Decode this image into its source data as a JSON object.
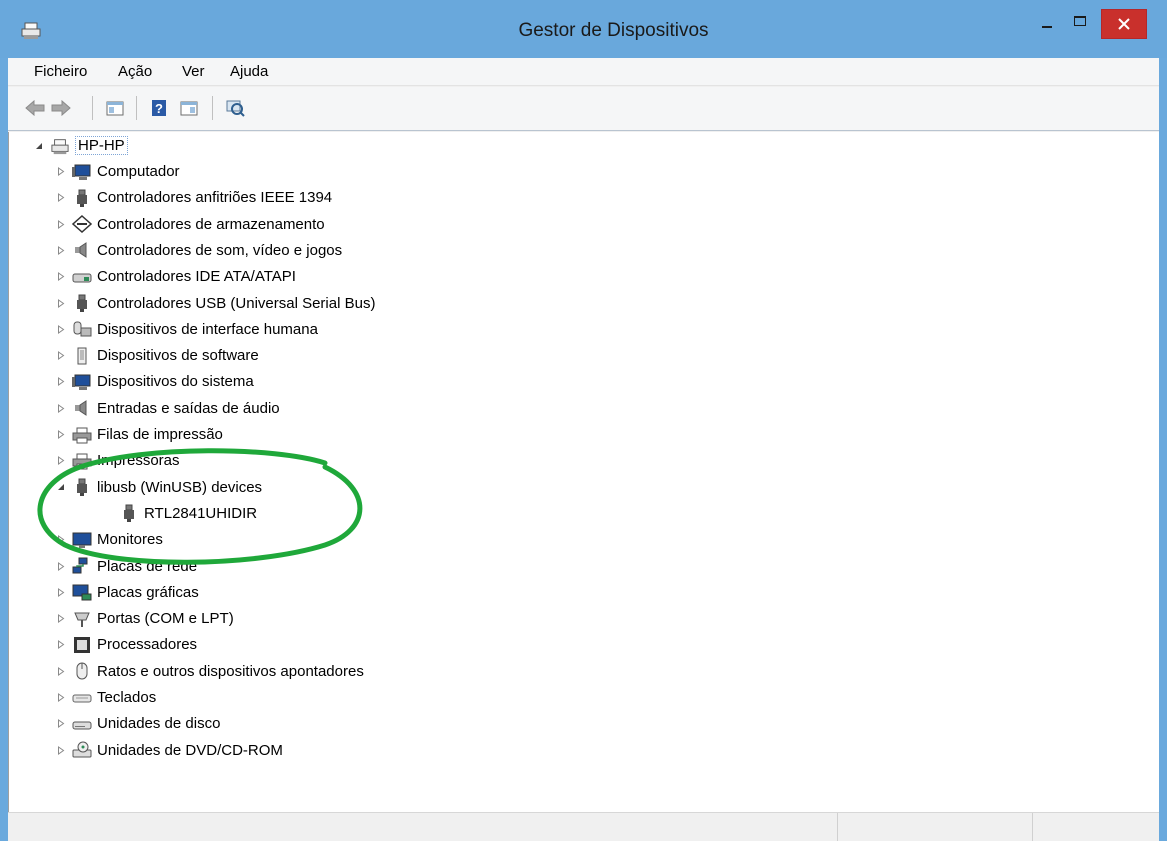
{
  "window": {
    "title": "Gestor de Dispositivos"
  },
  "menu": [
    {
      "label": "Ficheiro"
    },
    {
      "label": "Ação"
    },
    {
      "label": "Ver"
    },
    {
      "label": "Ajuda"
    }
  ],
  "tree": {
    "root": {
      "label": "HP-HP",
      "expanded": true
    },
    "items": [
      {
        "label": "Computador",
        "icon": "computer-icon",
        "expander": "collapsed"
      },
      {
        "label": "Controladores anfitriões IEEE 1394",
        "icon": "usb-plug-icon",
        "expander": "collapsed"
      },
      {
        "label": "Controladores de armazenamento",
        "icon": "storage-controller-icon",
        "expander": "collapsed"
      },
      {
        "label": "Controladores de som, vídeo e jogos",
        "icon": "speaker-icon",
        "expander": "collapsed"
      },
      {
        "label": "Controladores IDE ATA/ATAPI",
        "icon": "ide-controller-icon",
        "expander": "collapsed"
      },
      {
        "label": "Controladores USB (Universal Serial Bus)",
        "icon": "usb-plug-icon",
        "expander": "collapsed"
      },
      {
        "label": "Dispositivos de interface humana",
        "icon": "hid-icon",
        "expander": "collapsed"
      },
      {
        "label": "Dispositivos de software",
        "icon": "software-device-icon",
        "expander": "collapsed"
      },
      {
        "label": "Dispositivos do sistema",
        "icon": "computer-icon",
        "expander": "collapsed"
      },
      {
        "label": "Entradas e saídas de áudio",
        "icon": "speaker-icon",
        "expander": "collapsed"
      },
      {
        "label": "Filas de impressão",
        "icon": "printer-icon",
        "expander": "collapsed"
      },
      {
        "label": "Impressoras",
        "icon": "printer-icon",
        "expander": "collapsed"
      },
      {
        "label": "libusb (WinUSB) devices",
        "icon": "usb-plug-icon",
        "expander": "expanded"
      },
      {
        "label": "RTL2841UHIDIR",
        "icon": "usb-plug-icon",
        "expander": "none",
        "child": true
      },
      {
        "label": "Monitores",
        "icon": "monitor-icon",
        "expander": "collapsed"
      },
      {
        "label": "Placas de rede",
        "icon": "network-icon",
        "expander": "collapsed"
      },
      {
        "label": "Placas gráficas",
        "icon": "display-adapter-icon",
        "expander": "collapsed"
      },
      {
        "label": "Portas (COM e LPT)",
        "icon": "port-icon",
        "expander": "collapsed"
      },
      {
        "label": "Processadores",
        "icon": "processor-icon",
        "expander": "collapsed"
      },
      {
        "label": "Ratos e outros dispositivos apontadores",
        "icon": "mouse-icon",
        "expander": "collapsed"
      },
      {
        "label": "Teclados",
        "icon": "keyboard-icon",
        "expander": "collapsed"
      },
      {
        "label": "Unidades de disco",
        "icon": "disk-drive-icon",
        "expander": "collapsed"
      },
      {
        "label": "Unidades de DVD/CD-ROM",
        "icon": "dvd-drive-icon",
        "expander": "collapsed"
      }
    ]
  },
  "colors": {
    "titlebar": "#69a8dc",
    "close_button": "#c9302c",
    "annotation": "#1fa83a",
    "selection_border": "#7ea5d6"
  }
}
